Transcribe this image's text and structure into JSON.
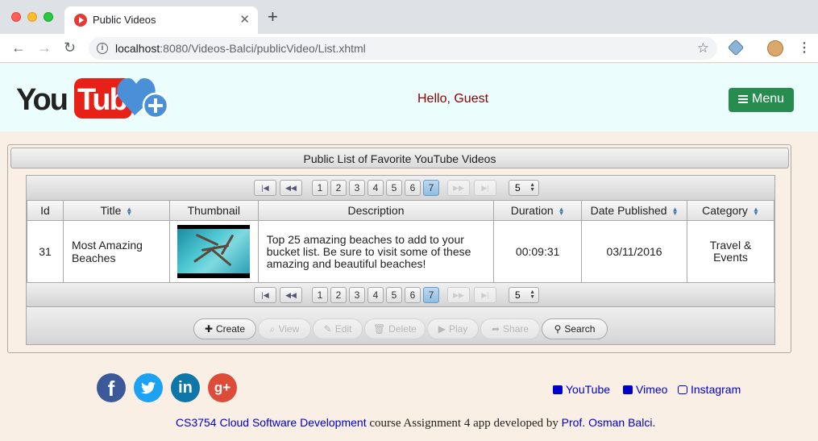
{
  "browser": {
    "tab_title": "Public Videos",
    "url_host": "localhost",
    "url_rest": ":8080/Videos-Balci/publicVideo/List.xhtml"
  },
  "header": {
    "logo_you": "You",
    "logo_tube": "Tube",
    "greeting": "Hello, Guest",
    "menu_label": "Menu"
  },
  "panel": {
    "title": "Public List of Favorite YouTube Videos"
  },
  "paginator": {
    "pages": [
      "1",
      "2",
      "3",
      "4",
      "5",
      "6",
      "7"
    ],
    "current_page": "7",
    "rows_per_page": "5"
  },
  "table": {
    "columns": [
      "Id",
      "Title",
      "Thumbnail",
      "Description",
      "Duration",
      "Date Published",
      "Category"
    ],
    "rows": [
      {
        "id": "31",
        "title": "Most Amazing Beaches",
        "description": "Top 25 amazing beaches to add to your bucket list. Be sure to visit some of these amazing and beautiful beaches!",
        "duration": "00:09:31",
        "date_published": "03/11/2016",
        "category": "Travel & Events"
      }
    ]
  },
  "actions": {
    "create": "Create",
    "view": "View",
    "edit": "Edit",
    "delete": "Delete",
    "play": "Play",
    "share": "Share",
    "search": "Search"
  },
  "footer": {
    "youtube": "YouTube",
    "vimeo": "Vimeo",
    "instagram": "Instagram",
    "course_link": "CS3754 Cloud Software Development",
    "middle_text": " course Assignment 4 app developed by ",
    "author_link": "Prof. Osman Balci",
    "end": "."
  },
  "colors": {
    "menu_button": "#278c4f",
    "greeting": "#8b0000",
    "header_bg": "#ebfdfd",
    "page_bg": "#f9efe4",
    "link": "#0000cc"
  }
}
